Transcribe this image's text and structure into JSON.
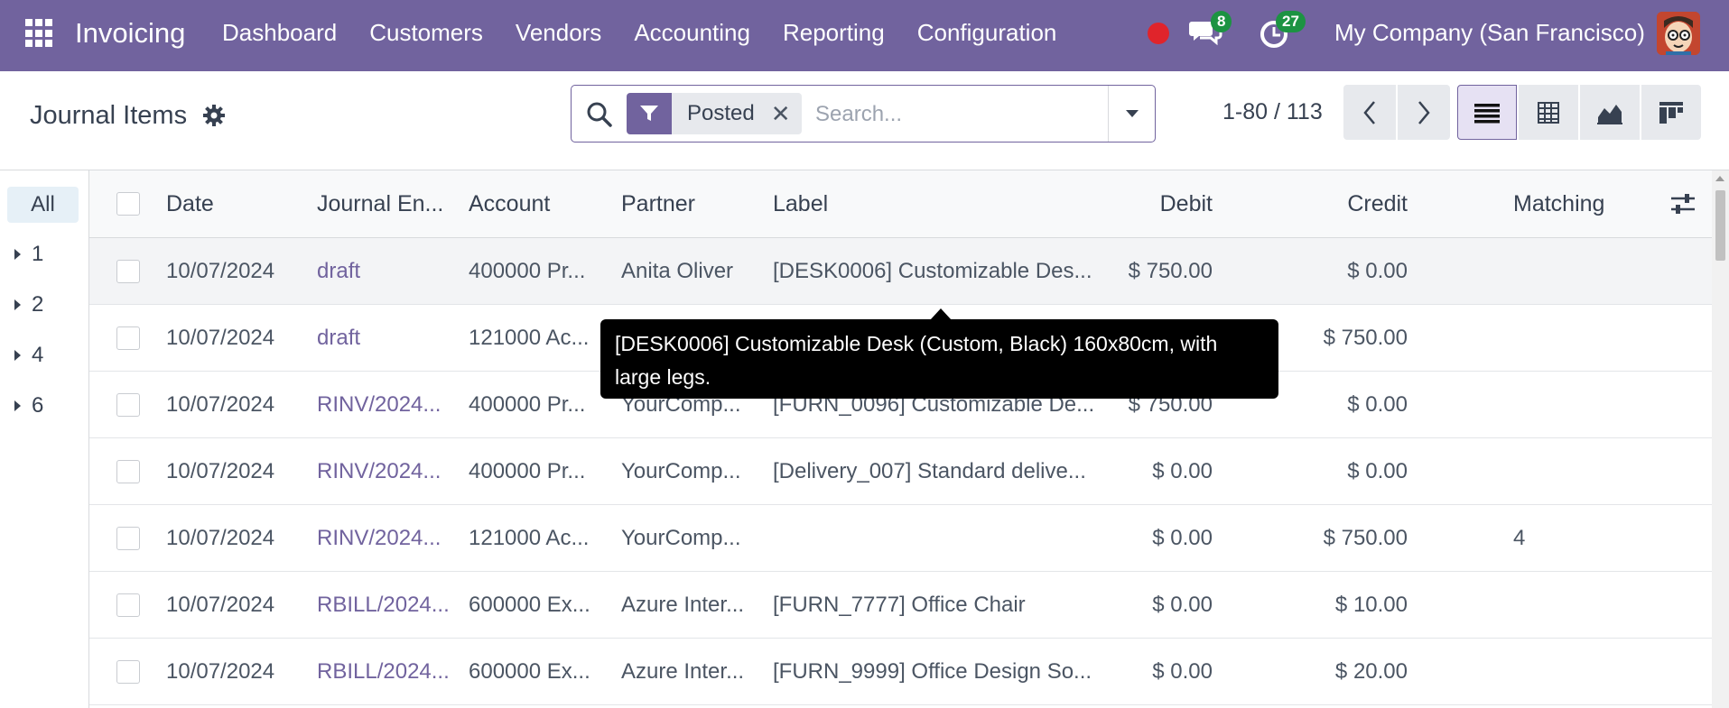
{
  "navbar": {
    "app_name": "Invoicing",
    "menu": [
      "Dashboard",
      "Customers",
      "Vendors",
      "Accounting",
      "Reporting",
      "Configuration"
    ],
    "messages_count": "8",
    "activities_count": "27",
    "company": "My Company (San Francisco)",
    "brand_color": "#71639e",
    "status_color": "#e0242b",
    "badge_color": "#1c9342"
  },
  "control": {
    "title": "Journal Items",
    "facet_label": "Posted",
    "search_placeholder": "Search...",
    "pager": "1-80 / 113",
    "views": [
      "list-view-icon",
      "pivot-view-icon",
      "graph-view-icon",
      "kanban-view-icon"
    ],
    "active_view": "list-view-icon"
  },
  "groups": {
    "all_label": "All",
    "items": [
      "1",
      "2",
      "4",
      "6"
    ]
  },
  "table": {
    "headers": {
      "date": "Date",
      "journal_entry": "Journal En...",
      "account": "Account",
      "partner": "Partner",
      "label": "Label",
      "debit": "Debit",
      "credit": "Credit",
      "matching": "Matching"
    },
    "rows": [
      {
        "date": "10/07/2024",
        "entry": "draft",
        "account": "400000 Pr...",
        "partner": "Anita Oliver",
        "label": "[DESK0006] Customizable Des...",
        "debit": "$ 750.00",
        "credit": "$ 0.00",
        "matching": ""
      },
      {
        "date": "10/07/2024",
        "entry": "draft",
        "account": "121000 Ac...",
        "partner": "",
        "label": "",
        "debit": "$ 0.00",
        "credit": "$ 750.00",
        "matching": ""
      },
      {
        "date": "10/07/2024",
        "entry": "RINV/2024...",
        "account": "400000 Pr...",
        "partner": "YourComp...",
        "label": "[FURN_0096] Customizable De...",
        "debit": "$ 750.00",
        "credit": "$ 0.00",
        "matching": ""
      },
      {
        "date": "10/07/2024",
        "entry": "RINV/2024...",
        "account": "400000 Pr...",
        "partner": "YourComp...",
        "label": "[Delivery_007] Standard delive...",
        "debit": "$ 0.00",
        "credit": "$ 0.00",
        "matching": ""
      },
      {
        "date": "10/07/2024",
        "entry": "RINV/2024...",
        "account": "121000 Ac...",
        "partner": "YourComp...",
        "label": "",
        "debit": "$ 0.00",
        "credit": "$ 750.00",
        "matching": "4"
      },
      {
        "date": "10/07/2024",
        "entry": "RBILL/2024...",
        "account": "600000 Ex...",
        "partner": "Azure Inter...",
        "label": "[FURN_7777] Office Chair",
        "debit": "$ 0.00",
        "credit": "$ 10.00",
        "matching": ""
      },
      {
        "date": "10/07/2024",
        "entry": "RBILL/2024...",
        "account": "600000 Ex...",
        "partner": "Azure Inter...",
        "label": "[FURN_9999] Office Design So...",
        "debit": "$ 0.00",
        "credit": "$ 20.00",
        "matching": ""
      }
    ]
  },
  "tooltip": {
    "text": "[DESK0006] Customizable Desk (Custom, Black) 160x80cm, with large legs."
  }
}
